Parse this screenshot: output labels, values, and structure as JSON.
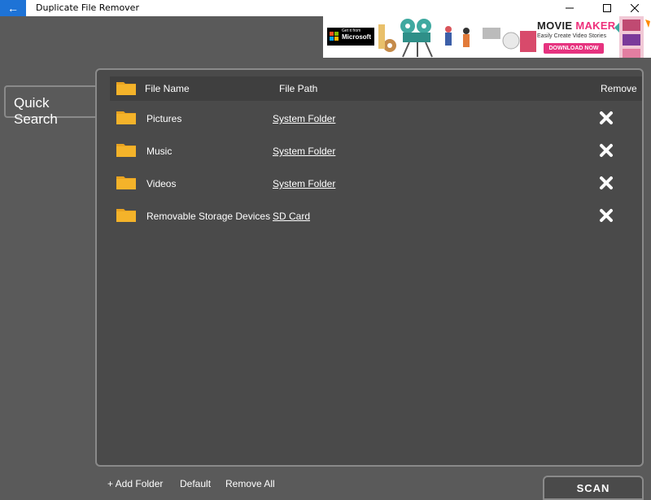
{
  "window": {
    "title": "Duplicate File Remover",
    "back_glyph": "←",
    "controls": [
      "minimize",
      "maximize",
      "close"
    ]
  },
  "ad": {
    "store_badge_small": "Get it from",
    "store_badge_big": "Microsoft",
    "title_part1": "MOVIE ",
    "title_part2": "MAKER",
    "subtitle": "Easily Create Video Stories",
    "cta": "DOWNLOAD NOW",
    "accent_color": "#e6337f"
  },
  "quick_search": {
    "label": "Quick Search"
  },
  "table": {
    "headers": {
      "name": "File Name",
      "path": "File Path",
      "remove": "Remove"
    },
    "rows": [
      {
        "name": "Pictures",
        "path": "System Folder"
      },
      {
        "name": "Music",
        "path": "System Folder"
      },
      {
        "name": "Videos",
        "path": "System Folder"
      },
      {
        "name": "Removable Storage Devices",
        "path": "SD Card"
      }
    ]
  },
  "footer": {
    "add_folder": "+ Add Folder",
    "default": "Default",
    "remove_all": "Remove All",
    "scan": "SCAN"
  },
  "colors": {
    "accent": "#1e73d6",
    "folder": "#f4b32a",
    "background": "#5a5a5a",
    "panel": "#4a4a4a"
  }
}
